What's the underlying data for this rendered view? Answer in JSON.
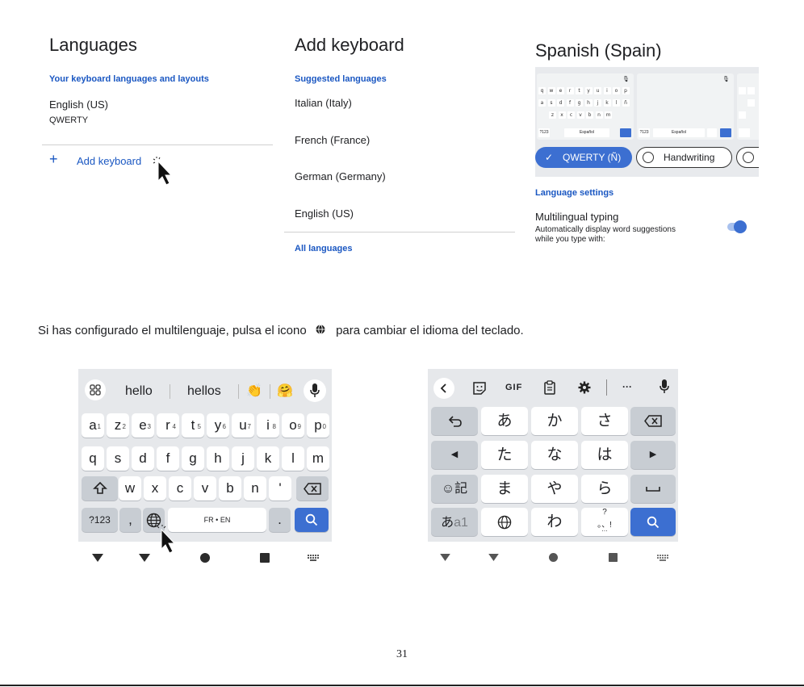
{
  "panel_languages": {
    "title": "Languages",
    "section_label": "Your keyboard languages and layouts",
    "language": "English (US)",
    "layout": "QWERTY",
    "add_keyboard": "Add keyboard",
    "add_icon": "+"
  },
  "panel_add_keyboard": {
    "title": "Add keyboard",
    "section_label": "Suggested languages",
    "languages": [
      "Italian (Italy)",
      "French (France)",
      "German (Germany)",
      "English (US)"
    ],
    "all_languages": "All languages"
  },
  "panel_spanish": {
    "title": "Spanish (Spain)",
    "preview_rows": [
      [
        "q",
        "w",
        "e",
        "r",
        "t",
        "y",
        "u",
        "i",
        "o",
        "p"
      ],
      [
        "a",
        "s",
        "d",
        "f",
        "g",
        "h",
        "j",
        "k",
        "l",
        "ñ"
      ],
      [
        "z",
        "x",
        "c",
        "v",
        "b",
        "n",
        "m"
      ]
    ],
    "preview_symbols_key": "?123",
    "preview_space_label": "Español",
    "chip_qwerty": "QWERTY (Ñ)",
    "chip_check": "✓",
    "chip_handwriting": "Handwriting",
    "settings_label": "Language settings",
    "multilingual_title": "Multilingual typing",
    "multilingual_desc_1": "Automatically display word suggestions",
    "multilingual_desc_2": "while you type with:",
    "toggle_on": true
  },
  "caption": {
    "before": "Si has configurado el multilenguaje, pulsa el icono",
    "icon": "globe-icon",
    "after": "para cambiar el idioma del teclado."
  },
  "keyboard_latin": {
    "suggestions": [
      "hello",
      "hellos"
    ],
    "emoji_1": "👏",
    "emoji_2": "🤗",
    "row1": [
      {
        "k": "a",
        "n": "1"
      },
      {
        "k": "z",
        "n": "2"
      },
      {
        "k": "e",
        "n": "3"
      },
      {
        "k": "r",
        "n": "4"
      },
      {
        "k": "t",
        "n": "5"
      },
      {
        "k": "y",
        "n": "6"
      },
      {
        "k": "u",
        "n": "7"
      },
      {
        "k": "i",
        "n": "8"
      },
      {
        "k": "o",
        "n": "9"
      },
      {
        "k": "p",
        "n": "0"
      }
    ],
    "row2": [
      "q",
      "s",
      "d",
      "f",
      "g",
      "h",
      "j",
      "k",
      "l",
      "m"
    ],
    "row3": [
      "w",
      "x",
      "c",
      "v",
      "b",
      "n",
      "'"
    ],
    "symbols_key": "?123",
    "comma_key": ",",
    "space_label": "FR • EN",
    "period_key": "."
  },
  "keyboard_japanese": {
    "toolbar_gif": "GIF",
    "toolbar_more": "···",
    "kana": [
      [
        "あ",
        "か",
        "さ"
      ],
      [
        "た",
        "な",
        "は"
      ],
      [
        "ま",
        "や",
        "ら"
      ],
      [
        "わ"
      ]
    ],
    "emoji_kanji": "☺記",
    "mode_hiragana": "あ",
    "mode_alpha": "a1",
    "punct_question": "?",
    "punct_marks": "。、!",
    "punct_dots": "…",
    "left_arrow": "◀",
    "right_arrow": "▶"
  },
  "page_number": "31"
}
